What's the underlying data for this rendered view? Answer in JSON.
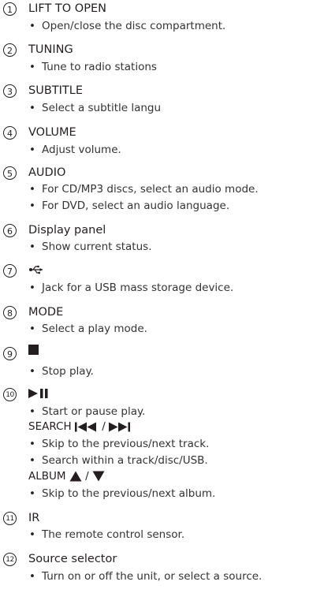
{
  "items": [
    {
      "num": "1",
      "title": "LIFT TO OPEN",
      "bullets": [
        "Open/close the disc compartment."
      ]
    },
    {
      "num": "2",
      "title": "TUNING",
      "bullets": [
        "Tune to radio stations"
      ]
    },
    {
      "num": "3",
      "title": "SUBTITLE",
      "bullets": [
        "Select a subtitle langu"
      ]
    },
    {
      "num": "4",
      "title": "VOLUME",
      "bullets": [
        "Adjust volume."
      ]
    },
    {
      "num": "5",
      "title": "AUDIO",
      "bullets": [
        "For CD/MP3 discs, select an audio mode.",
        "For DVD, select an audio language."
      ]
    },
    {
      "num": "6",
      "title": "Display panel",
      "bullets": [
        "Show current status."
      ]
    },
    {
      "num": "7",
      "title_icon": "usb-icon",
      "bullets": [
        "Jack for a USB mass storage device."
      ]
    },
    {
      "num": "8",
      "title": "MODE",
      "bullets": [
        "Select a play mode."
      ]
    },
    {
      "num": "9",
      "title_icon": "stop-icon",
      "bullets": [
        "Stop play."
      ]
    },
    {
      "num": "10",
      "title_icon": "play-pause-icon",
      "bullets": [
        "Start or pause play."
      ]
    },
    {
      "num": "11",
      "title": "IR",
      "bullets": [
        "The remote control sensor."
      ]
    },
    {
      "num": "12",
      "title": "Source selector",
      "bullets": [
        "Turn on or off the unit, or select a source."
      ]
    }
  ],
  "search": {
    "label": "SEARCH",
    "separator": "/",
    "icons": [
      "skip-previous-icon",
      "skip-next-icon"
    ],
    "bullets": [
      "Skip to the previous/next track.",
      "Search within a track/disc/USB."
    ]
  },
  "album": {
    "label": "ALBUM",
    "separator": "/",
    "icons": [
      "triangle-up-icon",
      "triangle-down-icon"
    ],
    "bullets": [
      "Skip to the previous/next album."
    ]
  }
}
